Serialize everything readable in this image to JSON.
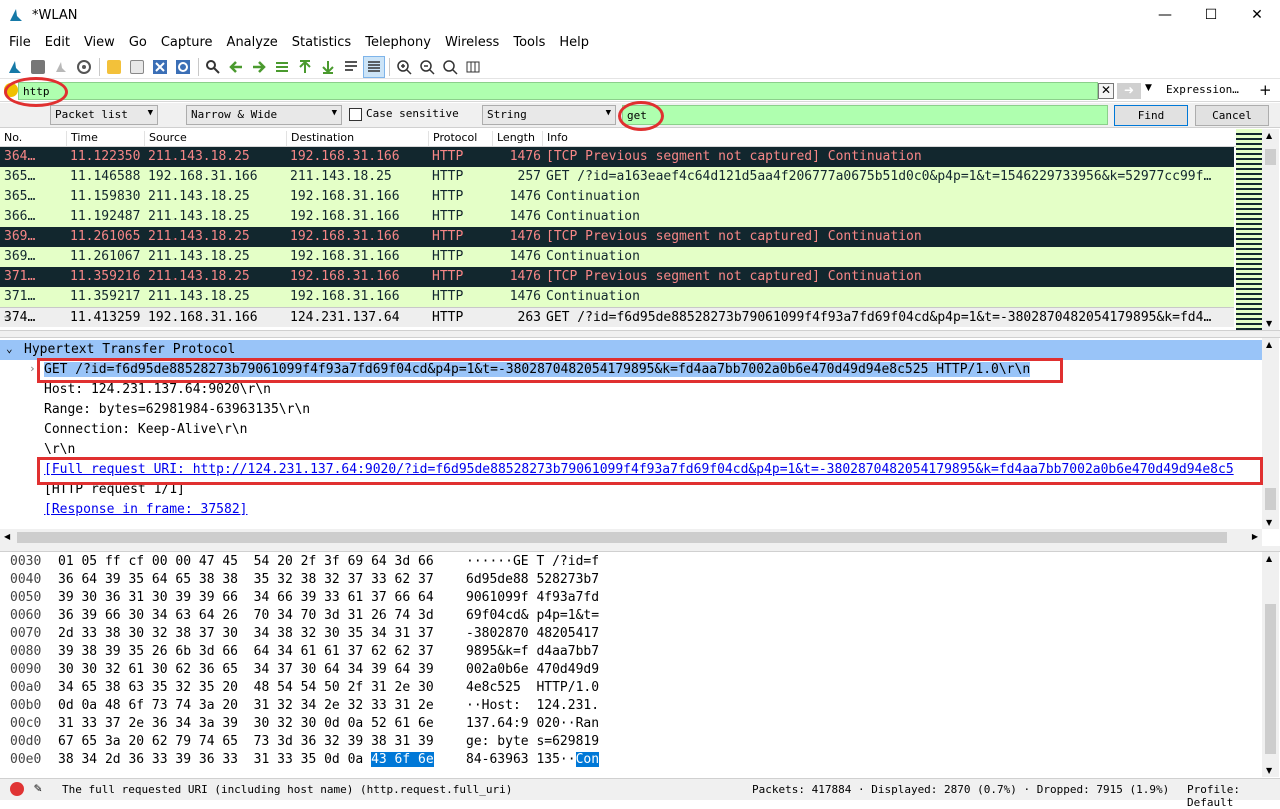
{
  "window": {
    "title": "*WLAN",
    "min": "—",
    "max": "☐",
    "close": "✕"
  },
  "menu": [
    "File",
    "Edit",
    "View",
    "Go",
    "Capture",
    "Analyze",
    "Statistics",
    "Telephony",
    "Wireless",
    "Tools",
    "Help"
  ],
  "filter": {
    "value": "http",
    "expression_label": "Expression…",
    "plus": "+"
  },
  "find": {
    "scope": "Packet list",
    "width": "Narrow & Wide",
    "case_label": "Case sensitive",
    "type": "String",
    "query": "get",
    "find_label": "Find",
    "cancel_label": "Cancel"
  },
  "columns": [
    "No.",
    "Time",
    "Source",
    "Destination",
    "Protocol",
    "Length",
    "Info"
  ],
  "packets": [
    {
      "no": "364…",
      "time": "11.122350",
      "src": "211.143.18.25",
      "dst": "192.168.31.166",
      "proto": "HTTP",
      "len": "1476",
      "info": "[TCP Previous segment not captured] Continuation",
      "kind": "tcp"
    },
    {
      "no": "365…",
      "time": "11.146588",
      "src": "192.168.31.166",
      "dst": "211.143.18.25",
      "proto": "HTTP",
      "len": "257",
      "info": "GET /?id=a163eaef4c64d121d5aa4f206777a0675b51d0c0&p4p=1&t=1546229733956&k=52977cc99f…",
      "kind": "http"
    },
    {
      "no": "365…",
      "time": "11.159830",
      "src": "211.143.18.25",
      "dst": "192.168.31.166",
      "proto": "HTTP",
      "len": "1476",
      "info": "Continuation",
      "kind": "http"
    },
    {
      "no": "366…",
      "time": "11.192487",
      "src": "211.143.18.25",
      "dst": "192.168.31.166",
      "proto": "HTTP",
      "len": "1476",
      "info": "Continuation",
      "kind": "http"
    },
    {
      "no": "369…",
      "time": "11.261065",
      "src": "211.143.18.25",
      "dst": "192.168.31.166",
      "proto": "HTTP",
      "len": "1476",
      "info": "[TCP Previous segment not captured] Continuation",
      "kind": "tcp"
    },
    {
      "no": "369…",
      "time": "11.261067",
      "src": "211.143.18.25",
      "dst": "192.168.31.166",
      "proto": "HTTP",
      "len": "1476",
      "info": "Continuation",
      "kind": "http"
    },
    {
      "no": "371…",
      "time": "11.359216",
      "src": "211.143.18.25",
      "dst": "192.168.31.166",
      "proto": "HTTP",
      "len": "1476",
      "info": "[TCP Previous segment not captured] Continuation",
      "kind": "tcp"
    },
    {
      "no": "371…",
      "time": "11.359217",
      "src": "211.143.18.25",
      "dst": "192.168.31.166",
      "proto": "HTTP",
      "len": "1476",
      "info": "Continuation",
      "kind": "http"
    },
    {
      "no": "374…",
      "time": "11.413259",
      "src": "192.168.31.166",
      "dst": "124.231.137.64",
      "proto": "HTTP",
      "len": "263",
      "info": "GET /?id=f6d95de88528273b79061099f4f93a7fd69f04cd&p4p=1&t=-3802870482054179895&k=fd4…",
      "kind": "sel"
    }
  ],
  "detail": {
    "proto": "Hypertext Transfer Protocol",
    "request_line": "GET /?id=f6d95de88528273b79061099f4f93a7fd69f04cd&p4p=1&t=-3802870482054179895&k=fd4aa7bb7002a0b6e470d49d94e8c525 HTTP/1.0\\r\\n",
    "host": "Host: 124.231.137.64:9020\\r\\n",
    "range": "Range: bytes=62981984-63963135\\r\\n",
    "connection": "Connection: Keep-Alive\\r\\n",
    "crlf": "\\r\\n",
    "full_uri": "[Full request URI: http://124.231.137.64:9020/?id=f6d95de88528273b79061099f4f93a7fd69f04cd&p4p=1&t=-3802870482054179895&k=fd4aa7bb7002a0b6e470d49d94e8c5",
    "request_count": "[HTTP request 1/1]",
    "response_frame": "[Response in frame: 37582]"
  },
  "bytes": [
    {
      "off": "0030",
      "hex": "01 05 ff cf 00 00 47 45  54 20 2f 3f 69 64 3d 66",
      "asc": "······GE T /?id=f"
    },
    {
      "off": "0040",
      "hex": "36 64 39 35 64 65 38 38  35 32 38 32 37 33 62 37",
      "asc": "6d95de88 528273b7"
    },
    {
      "off": "0050",
      "hex": "39 30 36 31 30 39 39 66  34 66 39 33 61 37 66 64",
      "asc": "9061099f 4f93a7fd"
    },
    {
      "off": "0060",
      "hex": "36 39 66 30 34 63 64 26  70 34 70 3d 31 26 74 3d",
      "asc": "69f04cd& p4p=1&t="
    },
    {
      "off": "0070",
      "hex": "2d 33 38 30 32 38 37 30  34 38 32 30 35 34 31 37",
      "asc": "-3802870 48205417"
    },
    {
      "off": "0080",
      "hex": "39 38 39 35 26 6b 3d 66  64 34 61 61 37 62 62 37",
      "asc": "9895&k=f d4aa7bb7"
    },
    {
      "off": "0090",
      "hex": "30 30 32 61 30 62 36 65  34 37 30 64 34 39 64 39",
      "asc": "002a0b6e 470d49d9"
    },
    {
      "off": "00a0",
      "hex": "34 65 38 63 35 32 35 20  48 54 54 50 2f 31 2e 30",
      "asc": "4e8c525  HTTP/1.0"
    },
    {
      "off": "00b0",
      "hex": "0d 0a 48 6f 73 74 3a 20  31 32 34 2e 32 33 31 2e",
      "asc": "··Host:  124.231."
    },
    {
      "off": "00c0",
      "hex": "31 33 37 2e 36 34 3a 39  30 32 30 0d 0a 52 61 6e",
      "asc": "137.64:9 020··Ran"
    },
    {
      "off": "00d0",
      "hex": "67 65 3a 20 62 79 74 65  73 3d 36 32 39 38 31 39",
      "asc": "ge: byte s=629819"
    }
  ],
  "bytes_last": {
    "off": "00e0",
    "hex_plain": "38 34 2d 36 33 39 36 33  31 33 35 0d 0a ",
    "hex_hl": "43 6f 6e",
    "asc_plain": "84-63963 135··",
    "asc_hl": "Con"
  },
  "status": {
    "message": "The full requested URI (including host name) (http.request.full_uri)",
    "packets": "Packets: 417884 · Displayed: 2870 (0.7%) · Dropped: 7915 (1.9%)",
    "profile": "Profile: Default"
  }
}
